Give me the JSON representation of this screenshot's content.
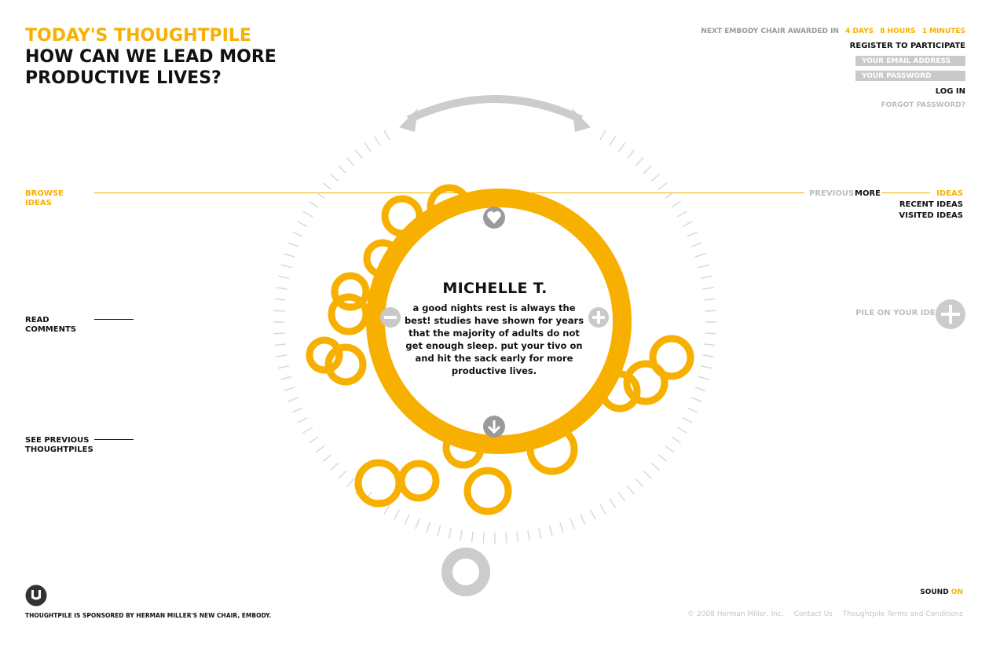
{
  "header": {
    "kicker": "TODAY'S THOUGHTPILE",
    "question": "HOW CAN WE LEAD MORE PRODUCTIVE LIVES?"
  },
  "award": {
    "label": "NEXT EMBODY CHAIR AWARDED IN",
    "days": "4 DAYS",
    "hours": "8 HOURS",
    "minutes": "1 MINUTES"
  },
  "account": {
    "register": "REGISTER TO PARTICIPATE",
    "email_placeholder": "YOUR EMAIL ADDRESS",
    "password_placeholder": "YOUR PASSWORD",
    "login": "LOG IN",
    "forgot": "FORGOT PASSWORD?"
  },
  "browse": {
    "label_1": "BROWSE",
    "label_2": "IDEAS",
    "previous": "PREVIOUS",
    "more": "MORE",
    "ideas": "IDEAS",
    "recent": "RECENT IDEAS",
    "visited": "VISITED IDEAS"
  },
  "nav": {
    "read_1": "READ",
    "read_2": "COMMENTS",
    "see_1": "SEE PREVIOUS",
    "see_2": "THOUGHTPILES"
  },
  "idea": {
    "author": "MICHELLE T.",
    "text": "a good nights rest is always the best! studies have shown for years that the majority of adults do not get enough sleep. put your tivo on and hit the sack early for more productive lives."
  },
  "pile": {
    "label": "PILE ON YOUR IDEA"
  },
  "footer": {
    "sponsor": "THOUGHTPILE IS SPONSORED BY HERMAN MILLER'S NEW CHAIR, EMBODY.",
    "sound_label": "SOUND",
    "sound_state": "ON",
    "copyright": "© 2008 Herman Miller, Inc.",
    "contact": "Contact Us",
    "terms": "Thoughtpile Terms and Conditions"
  },
  "colors": {
    "accent": "#f7b000",
    "muted": "#bdbdbd",
    "dark": "#111111"
  }
}
